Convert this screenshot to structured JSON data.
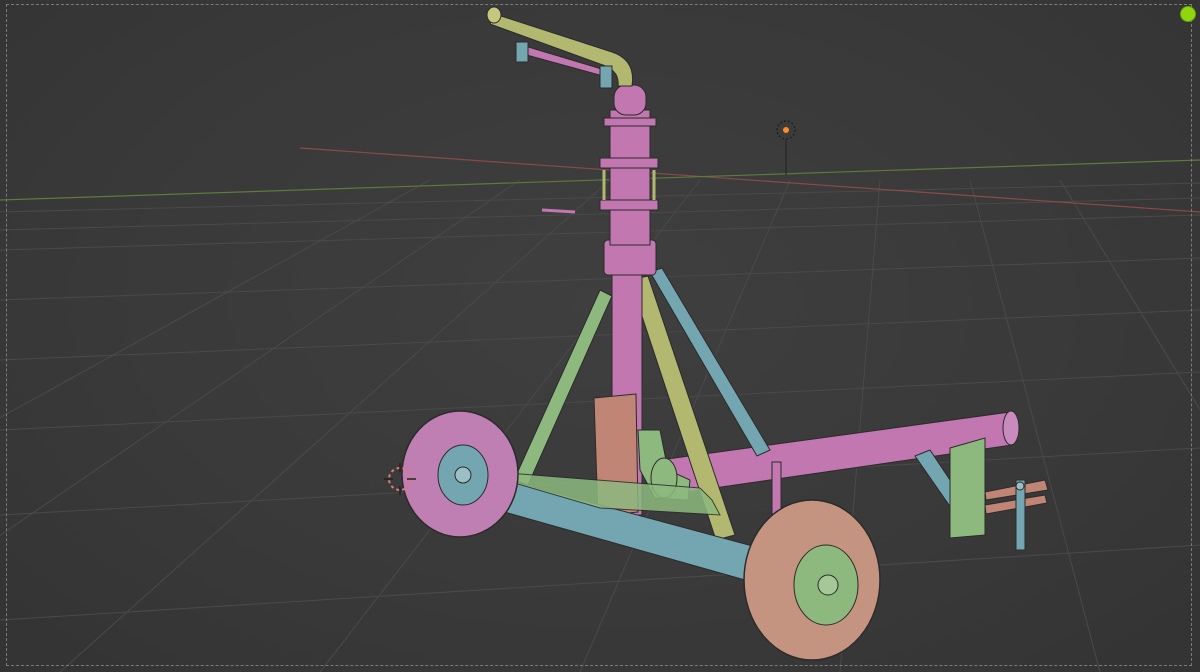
{
  "viewport": {
    "overlay_text": "",
    "colors": {
      "background": "#3a3a3a",
      "grid": "#4a4a4a",
      "axis_x": "#8a4a4a",
      "axis_y": "#5d7a3f",
      "pink": "#c277b1",
      "sage": "#8db97f",
      "teal": "#73a6b0",
      "olive": "#b2b870",
      "salmon": "#c18576",
      "tire": "#c07fb3",
      "tire2": "#c49480",
      "status": "#8fd60f"
    },
    "icons": [
      "light-object-icon",
      "3d-cursor-icon",
      "status-indicator-icon"
    ]
  }
}
